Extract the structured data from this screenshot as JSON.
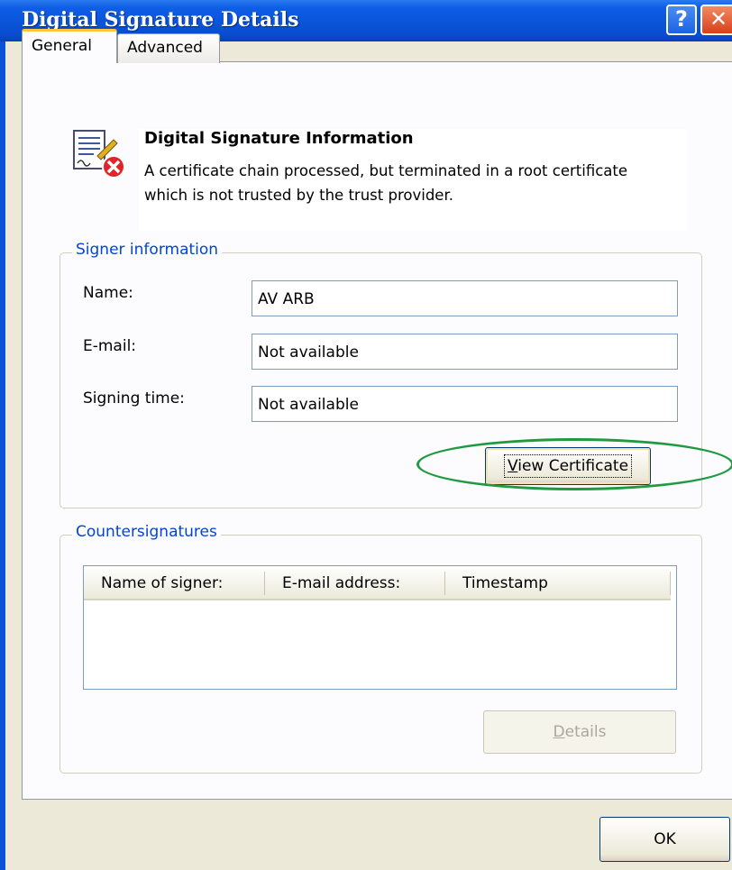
{
  "window": {
    "title": "Digital Signature Details",
    "help_glyph": "?",
    "close_glyph": "✕"
  },
  "tabs": [
    {
      "label": "General",
      "active": true
    },
    {
      "label": "Advanced",
      "active": false
    }
  ],
  "info": {
    "icon": "signed-document-error-icon",
    "title": "Digital Signature Information",
    "message": "A certificate chain processed, but terminated in a root certificate which is not trusted by the trust provider."
  },
  "signer": {
    "legend": "Signer information",
    "name_label": "Name:",
    "name_value": "AV ARB",
    "email_label": "E-mail:",
    "email_value": "Not available",
    "time_label": "Signing time:",
    "time_value": "Not available",
    "view_button_mnemonic": "V",
    "view_button_rest": "iew Certificate"
  },
  "countersignatures": {
    "legend": "Countersignatures",
    "columns": [
      "Name of signer:",
      "E-mail address:",
      "Timestamp"
    ],
    "rows": [],
    "details_mnemonic": "D",
    "details_rest": "etails"
  },
  "ok_label": "OK",
  "colors": {
    "title_bar": "#0a52d8",
    "legend_text": "#0046d5",
    "annotation": "#1f9a40",
    "dialog_bg": "#ece9d8"
  }
}
